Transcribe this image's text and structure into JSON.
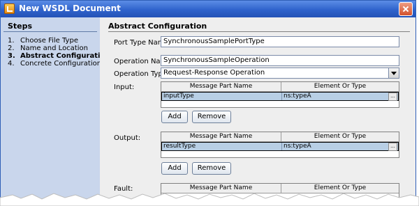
{
  "window": {
    "title": "New WSDL Document"
  },
  "steps": {
    "title": "Steps",
    "items": [
      {
        "num": "1.",
        "label": "Choose File Type"
      },
      {
        "num": "2.",
        "label": "Name and Location"
      },
      {
        "num": "3.",
        "label": "Abstract Configuration"
      },
      {
        "num": "4.",
        "label": "Concrete Configuration"
      }
    ]
  },
  "section": {
    "title": "Abstract Configuration"
  },
  "form": {
    "port_type_label": "Port Type Name:",
    "port_type_value": "SynchronousSamplePortType",
    "operation_name_label": "Operation Name:",
    "operation_name_value": "SynchronousSampleOperation",
    "operation_type_label": "Operation Type:",
    "operation_type_value": "Request-Response Operation"
  },
  "input": {
    "label": "Input:",
    "columns": [
      "Message Part Name",
      "Element Or Type"
    ],
    "rows": [
      {
        "part": "inputType",
        "type": "ns:typeA"
      }
    ],
    "add": "Add",
    "remove": "Remove"
  },
  "output": {
    "label": "Output:",
    "columns": [
      "Message Part Name",
      "Element Or Type"
    ],
    "rows": [
      {
        "part": "resultType",
        "type": "ns:typeA"
      }
    ],
    "add": "Add",
    "remove": "Remove"
  },
  "fault": {
    "label": "Fault:",
    "columns": [
      "Message Part Name",
      "Element Or Type"
    ]
  },
  "ellipsis": "..."
}
